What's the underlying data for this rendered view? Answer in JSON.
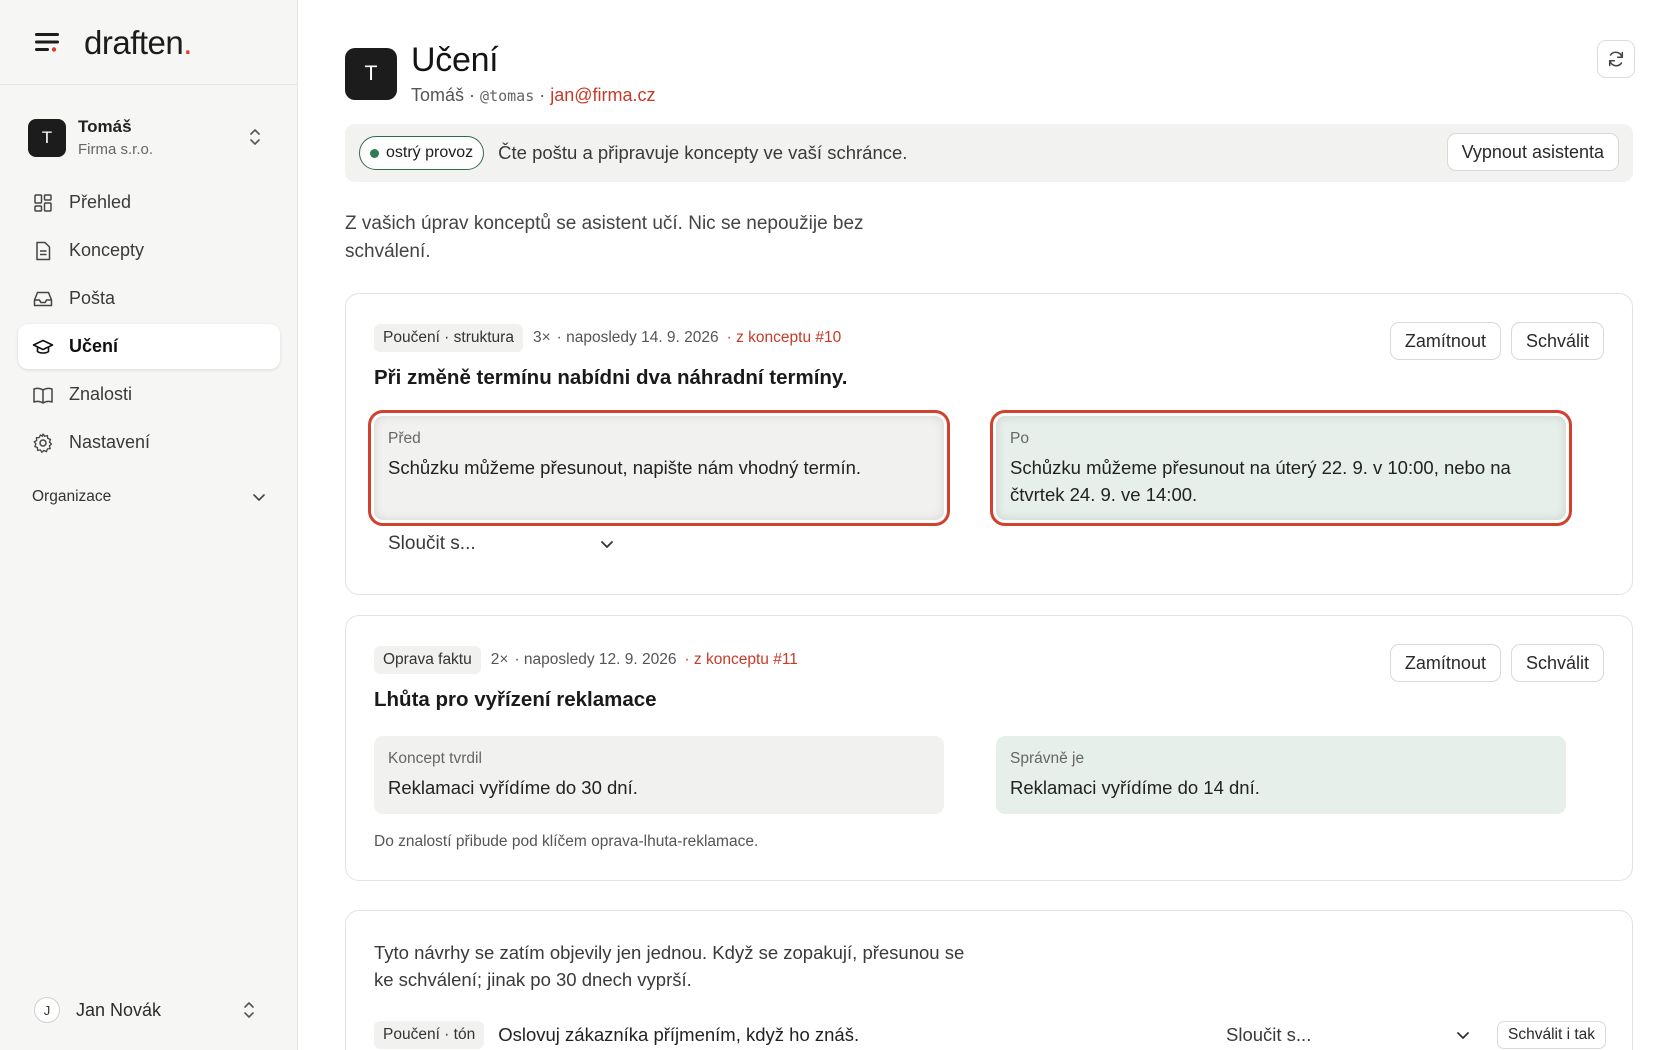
{
  "brand": {
    "name": "draften",
    "dot": "."
  },
  "org": {
    "initial": "T",
    "name": "Tomáš",
    "company": "Firma s.r.o."
  },
  "nav": {
    "items": [
      {
        "label": "Přehled",
        "icon": "dashboard-icon"
      },
      {
        "label": "Koncepty",
        "icon": "document-icon"
      },
      {
        "label": "Pošta",
        "icon": "inbox-icon"
      },
      {
        "label": "Učení",
        "icon": "graduation-cap-icon",
        "active": true
      },
      {
        "label": "Znalosti",
        "icon": "book-icon"
      },
      {
        "label": "Nastavení",
        "icon": "gear-icon"
      }
    ],
    "section": "Organizace"
  },
  "user": {
    "initial": "J",
    "name": "Jan Novák"
  },
  "page": {
    "initial": "T",
    "title": "Učení",
    "meta_name": "Tomáš",
    "sep": "·",
    "handle": "@tomas",
    "email": "jan@firma.cz"
  },
  "status": {
    "badge": "ostrý provoz",
    "text": "Čte poštu a připravuje koncepty ve vaší schránce.",
    "button": "Vypnout asistenta"
  },
  "intro": "Z vašich úprav konceptů se asistent učí. Nic se nepoužije bez schválení.",
  "cards": [
    {
      "tag": "Poučení · struktura",
      "count": "3×",
      "last": "· naposledy 14. 9. 2026",
      "source": "· z konceptu #10",
      "reject": "Zamítnout",
      "approve": "Schválit",
      "title": "Při změně termínu nabídni dva náhradní termíny.",
      "before_label": "Před",
      "before_text": "Schůzku můžeme přesunout, napište nám vhodný termín.",
      "after_label": "Po",
      "after_text": "Schůzku můžeme přesunout na úterý 22. 9. v 10:00, nebo na čtvrtek 24. 9. ve 14:00.",
      "merge": "Sloučit s..."
    },
    {
      "tag": "Oprava faktu",
      "count": "2×",
      "last": "· naposledy 12. 9. 2026",
      "source": "· z konceptu #11",
      "reject": "Zamítnout",
      "approve": "Schválit",
      "title": "Lhůta pro vyřízení reklamace",
      "before_label": "Koncept tvrdil",
      "before_text": "Reklamaci vyřídíme do 30 dní.",
      "after_label": "Správně je",
      "after_text": "Reklamaci vyřídíme do 14 dní.",
      "note": "Do znalostí přibude pod klíčem oprava-lhuta-reklamace."
    }
  ],
  "pending": {
    "note": "Tyto návrhy se zatím objevily jen jednou. Když se zopakují, přesunou se ke schválení; jinak po 30 dnech vyprší.",
    "tag": "Poučení · tón",
    "text": "Oslovuj zákazníka příjmením, když ho znáš.",
    "merge": "Sloučit s...",
    "approve_anyway": "Schválit i tak"
  },
  "colors": {
    "accent": "#d2402e",
    "live": "#2f7d55",
    "after_bg": "#e6efea"
  }
}
